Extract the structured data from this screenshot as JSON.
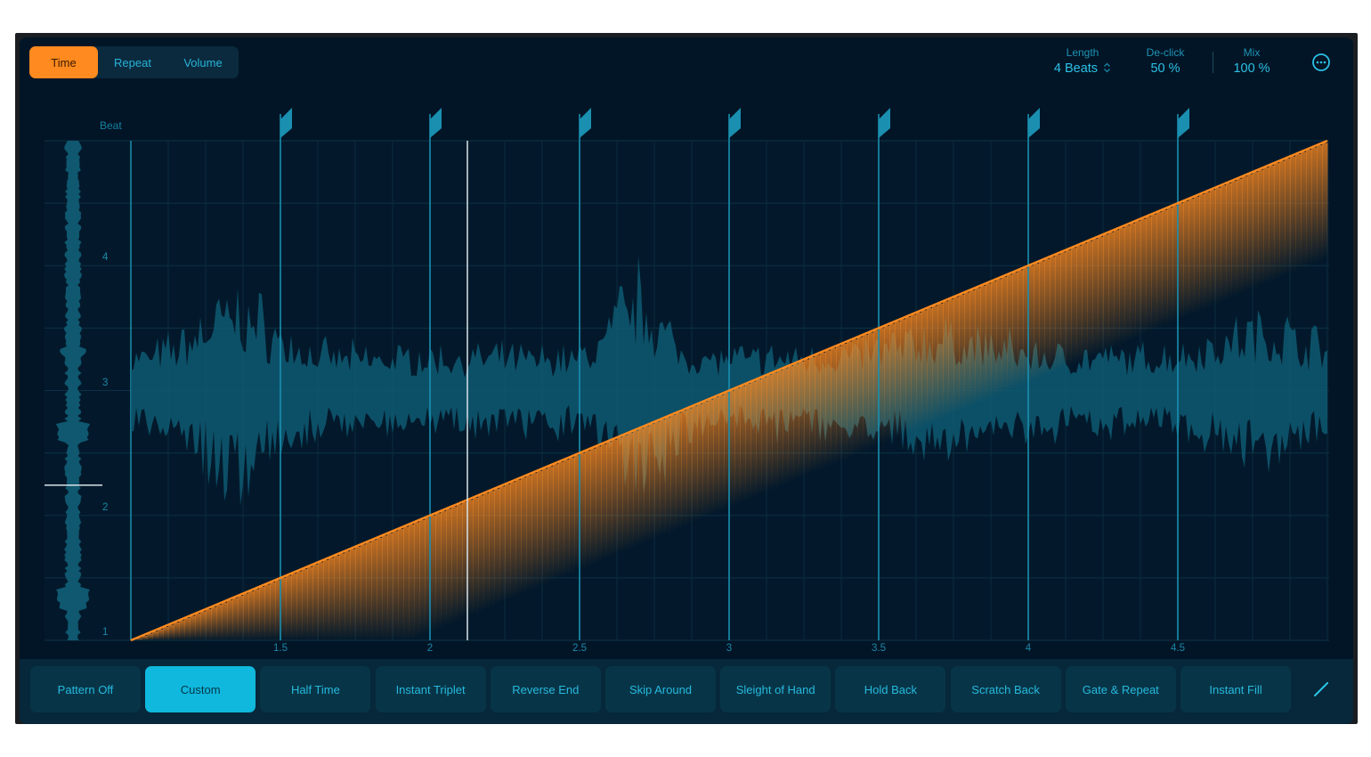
{
  "tabs": [
    {
      "label": "Time",
      "active": true
    },
    {
      "label": "Repeat",
      "active": false
    },
    {
      "label": "Volume",
      "active": false
    }
  ],
  "params": {
    "length": {
      "label": "Length",
      "value": "4 Beats",
      "icon": "up-down-chevron-icon"
    },
    "declick": {
      "label": "De-click",
      "value": "50 %"
    },
    "mix": {
      "label": "Mix",
      "value": "100 %"
    },
    "more_icon": "ellipsis-circle-icon"
  },
  "graph": {
    "y_axis_title": "Beat",
    "y_ticks": [
      "1",
      "2",
      "3",
      "4"
    ],
    "x_ticks": [
      "1.5",
      "2",
      "2.5",
      "3",
      "3.5",
      "4",
      "4.5"
    ],
    "x_range": [
      1,
      5
    ],
    "y_range": [
      1,
      5
    ],
    "curve": {
      "type": "linear",
      "from": [
        1,
        1
      ],
      "to": [
        5,
        5
      ],
      "color": "#ff8a1f"
    },
    "markers_at": [
      1.5,
      2,
      2.5,
      3,
      3.5,
      4,
      4.5
    ],
    "playhead_x": 2.125,
    "overview_playhead_beat": 2.1,
    "colors": {
      "waveform": "#0e5a72",
      "marker": "#1a8fb0",
      "curve": "#ff8a1f",
      "playhead": "#d8e4ea"
    }
  },
  "patterns": [
    {
      "label": "Pattern Off",
      "active": false
    },
    {
      "label": "Custom",
      "active": true
    },
    {
      "label": "Half Time",
      "active": false
    },
    {
      "label": "Instant Triplet",
      "active": false
    },
    {
      "label": "Reverse End",
      "active": false
    },
    {
      "label": "Skip Around",
      "active": false
    },
    {
      "label": "Sleight of Hand",
      "active": false
    },
    {
      "label": "Hold Back",
      "active": false
    },
    {
      "label": "Scratch Back",
      "active": false
    },
    {
      "label": "Gate & Repeat",
      "active": false
    },
    {
      "label": "Instant Fill",
      "active": false
    }
  ],
  "edit_icon": "pencil-icon"
}
